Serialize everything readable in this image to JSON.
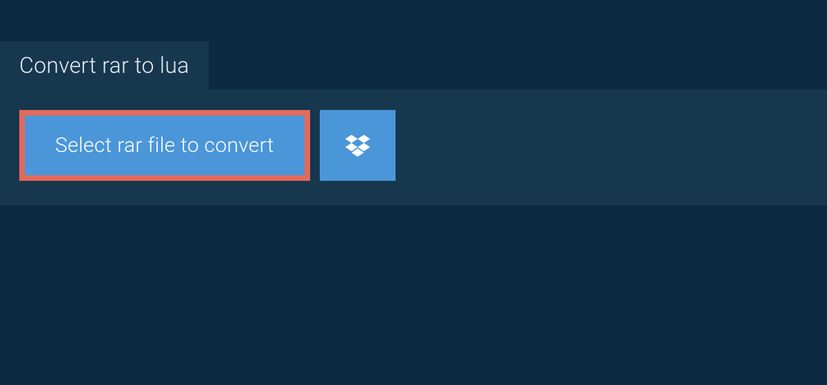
{
  "tab": {
    "title": "Convert rar to lua"
  },
  "actions": {
    "select_file_label": "Select rar file to convert"
  },
  "colors": {
    "background": "#0e2a42",
    "panel": "#17374f",
    "button": "#4a96d9",
    "highlight_border": "#e46a5a",
    "text": "#ffffff"
  }
}
